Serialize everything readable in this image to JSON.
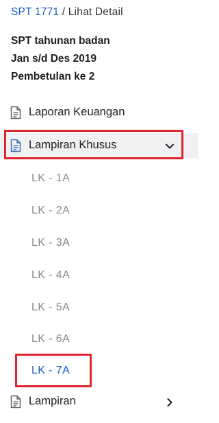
{
  "breadcrumb": {
    "link": "SPT 1771",
    "separator": " / ",
    "current": "Lihat Detail"
  },
  "info": {
    "line1": "SPT tahunan badan",
    "line2": "Jan s/d Des 2019",
    "line3": "Pembetulan ke 2"
  },
  "menu": {
    "laporan_keuangan": {
      "label": "Laporan Keuangan",
      "icon": "document-icon"
    },
    "lampiran_khusus": {
      "label": "Lampiran Khusus",
      "icon": "document-icon",
      "expanded": true,
      "chevron": "chevron-down-icon",
      "items": [
        "LK - 1A",
        "LK - 2A",
        "LK - 3A",
        "LK - 4A",
        "LK - 5A",
        "LK - 6A",
        "LK - 7A"
      ],
      "active_item": "LK - 7A"
    },
    "lampiran": {
      "label": "Lampiran",
      "icon": "document-icon",
      "chevron": "chevron-right-icon"
    }
  },
  "colors": {
    "link": "#1a5fc8",
    "highlight_border": "#e0232e",
    "sub_item": "#8a8a8a",
    "selected_row_bg": "#f0f1f3"
  }
}
